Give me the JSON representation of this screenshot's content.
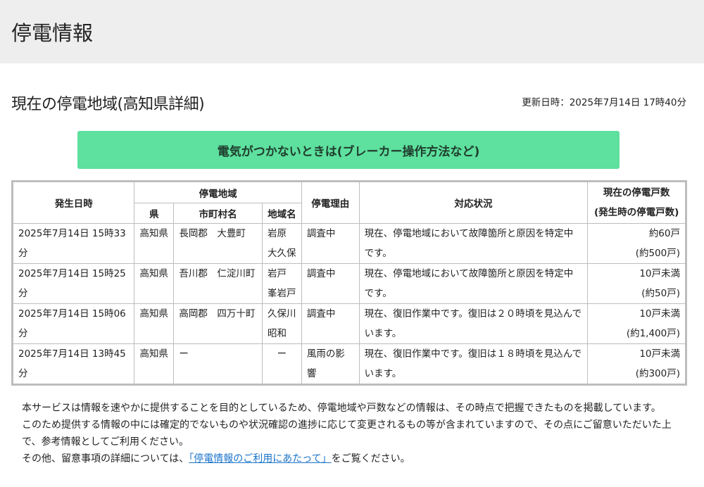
{
  "header": {
    "title": "停電情報"
  },
  "subhead": {
    "title": "現在の停電地域(高知県詳細)",
    "updated": "更新日時：2025年7月14日 17時40分"
  },
  "breaker_button": "電気がつかないときは(ブレーカー操作方法など)",
  "table": {
    "headers": {
      "datetime": "発生日時",
      "area": "停電地域",
      "pref": "県",
      "city": "市町村名",
      "district": "地域名",
      "reason": "停電理由",
      "status": "対応状況",
      "count_line1": "現在の停電戸数",
      "count_line2": "(発生時の停電戸数)"
    },
    "rows": [
      {
        "datetime": "2025年7月14日 15時33分",
        "pref": "高知県",
        "city": "長岡郡　大豊町",
        "district1": "岩原",
        "district2": "大久保",
        "reason": "調査中",
        "status": "現在、停電地域において故障箇所と原因を特定中です。",
        "current": "約60戸",
        "initial": "(約500戸)"
      },
      {
        "datetime": "2025年7月14日 15時25分",
        "pref": "高知県",
        "city": "吾川郡　仁淀川町",
        "district1": "岩戸",
        "district2": "峯岩戸",
        "reason": "調査中",
        "status": "現在、停電地域において故障箇所と原因を特定中です。",
        "current": "10戸未満",
        "initial": "(約50戸)"
      },
      {
        "datetime": "2025年7月14日 15時06分",
        "pref": "高知県",
        "city": "高岡郡　四万十町",
        "district1": "久保川",
        "district2": "昭和",
        "reason": "調査中",
        "status": "現在、復旧作業中です。復旧は２０時頃を見込んでいます。",
        "current": "10戸未満",
        "initial": "(約1,400戸)"
      },
      {
        "datetime": "2025年7月14日 13時45分",
        "pref": "高知県",
        "city": "ー",
        "district1": "ー",
        "district2": "",
        "reason": "風雨の影響",
        "status": "現在、復旧作業中です。復旧は１８時頃を見込んでいます。",
        "current": "10戸未満",
        "initial": "(約300戸)"
      }
    ]
  },
  "notes": {
    "p1": "本サービスは情報を速やかに提供することを目的としているため、停電地域や戸数などの情報は、その時点で把握できたものを掲載しています。",
    "p2": "このため提供する情報の中には確定的でないものや状況確認の進捗に応じて変更されるもの等が含まれていますので、その点にご留意いただいた上で、参考情報としてご利用ください。",
    "p3_prefix": "その他、留意事項の詳細については、",
    "p3_link": "「停電情報のご利用にあたって」",
    "p3_suffix": "をご覧ください。"
  },
  "colors": {
    "header_bg": "#eeeeee",
    "button_bg": "#5ee09e",
    "border": "#bdbdbd",
    "link": "#1a73c8"
  }
}
